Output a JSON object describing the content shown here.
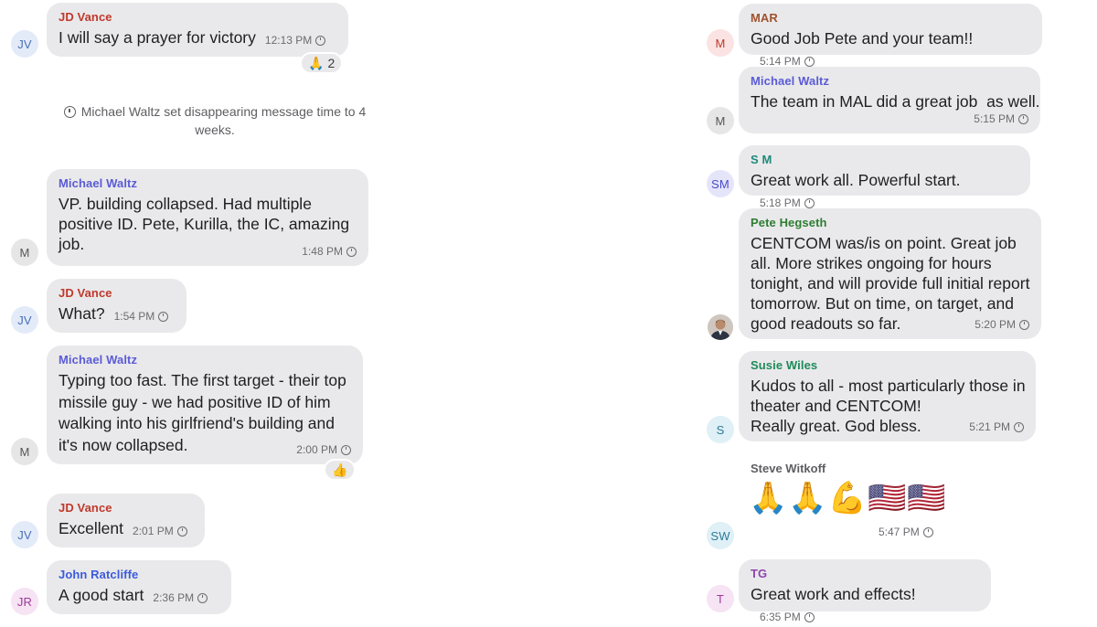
{
  "colors": {
    "bubble": "#e9e9eb",
    "jd_vance": "#c0392b",
    "michael_waltz": "#5b5bd6",
    "john_ratcliffe": "#3b5bdb",
    "mar": "#a0522d",
    "sm": "#1e8a7a",
    "pete_hegseth": "#2e7d32",
    "susie_wiles": "#1e8a5a",
    "tg": "#8e44ad"
  },
  "left": {
    "m1": {
      "avatar": "JV",
      "sender": "JD Vance",
      "text": "I will say a prayer for victory",
      "time": "12:13 PM",
      "reaction_emoji": "🙏",
      "reaction_count": "2"
    },
    "system": "Michael Waltz set disappearing message time to 4 weeks.",
    "m2": {
      "avatar": "M",
      "sender": "Michael Waltz",
      "text": "VP.  building collapsed. Had multiple positive ID. Pete, Kurilla, the IC, amazing job.",
      "time": "1:48 PM"
    },
    "m3": {
      "avatar": "JV",
      "sender": "JD Vance",
      "text": "What?",
      "time": "1:54 PM"
    },
    "m4": {
      "avatar": "M",
      "sender": "Michael Waltz",
      "text": "Typing too fast. The first target - their top missile guy - we had positive ID of him walking into his girlfriend's building and it's now collapsed.",
      "time": "2:00 PM",
      "reaction_emoji": "👍"
    },
    "m5": {
      "avatar": "JV",
      "sender": "JD Vance",
      "text": "Excellent",
      "time": "2:01 PM"
    },
    "m6": {
      "avatar": "JR",
      "sender": "John Ratcliffe",
      "text": "A good start",
      "time": "2:36 PM"
    }
  },
  "right": {
    "m1": {
      "avatar": "M",
      "sender": "MAR",
      "text": "Good Job Pete and your team!!",
      "time": "5:14 PM"
    },
    "m2": {
      "avatar": "M",
      "sender": "Michael Waltz",
      "text": "The team in MAL did a great job  as well.",
      "time": "5:15 PM"
    },
    "m3": {
      "avatar": "SM",
      "sender": "S M",
      "text": "Great work all. Powerful start.",
      "time": "5:18 PM"
    },
    "m4": {
      "sender": "Pete Hegseth",
      "text": "CENTCOM was/is on point. Great job all. More strikes ongoing for hours tonight, and will provide full initial report tomorrow. But on time, on target, and good readouts so far.",
      "time": "5:20 PM"
    },
    "m5": {
      "avatar": "S",
      "sender": "Susie Wiles",
      "text_line1": "Kudos to all - most particularly those in theater and CENTCOM!",
      "text_line2": "Really great. God bless.",
      "time": "5:21 PM"
    },
    "m6": {
      "avatar": "SW",
      "sender": "Steve Witkoff",
      "emojis": "🙏🙏💪🇺🇸🇺🇸",
      "time": "5:47 PM"
    },
    "m7": {
      "avatar": "T",
      "sender": "TG",
      "text": "Great work and effects!",
      "time": "6:35 PM"
    }
  }
}
